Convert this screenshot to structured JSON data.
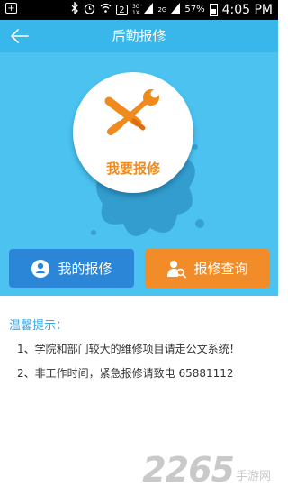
{
  "status_bar": {
    "net_badge": "2",
    "signal_3g": "3G",
    "signal_1x": "1X",
    "signal_2g": "2G",
    "battery": "57%",
    "time": "4:05 PM"
  },
  "header": {
    "title": "后勤报修"
  },
  "hero": {
    "repair_label": "我要报修"
  },
  "buttons": {
    "my_repairs": "我的报修",
    "repair_query": "报修查询"
  },
  "tips": {
    "title": "温馨提示：",
    "items": [
      "1、学院和部门较大的维修项目请走公文系统！",
      "2、非工作时间，紧急报修请致电 65881112"
    ]
  },
  "watermark": {
    "number": "2265",
    "suffix": "手游网"
  },
  "colors": {
    "header": "#39b6ea",
    "hero": "#4cc2f0",
    "my_repairs_button": "#2c86d8",
    "repair_query_button": "#f28c28",
    "accent_orange": "#f08a1c"
  }
}
